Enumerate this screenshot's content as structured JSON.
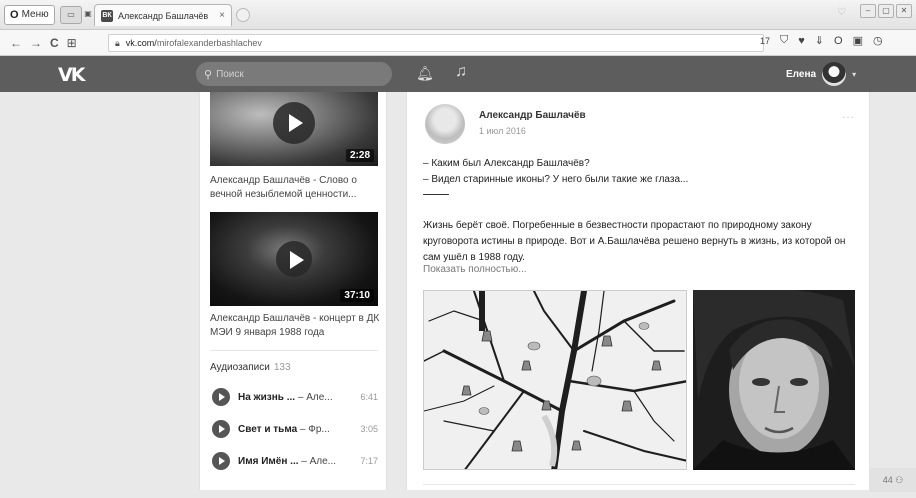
{
  "browser": {
    "menu_label": "Меню",
    "tab_title": "Александр Башлачёв",
    "tab_favicon": "ВК",
    "tab_close": "×",
    "url_host": "vk.com/",
    "url_path": "mirofalexanderbashlachev",
    "extension_count": "17",
    "nav_back": "←",
    "nav_forward": "→",
    "nav_reload": "C"
  },
  "vk_header": {
    "logo": "VK",
    "search_placeholder": "Поиск",
    "user_name": "Елена"
  },
  "videos": [
    {
      "title": "Александр Башлачёв - Слово о вечной незыблемой ценности...",
      "duration": "2:28"
    },
    {
      "title": "Александр Башлачёв - концерт в ДК МЭИ 9 января 1988 года",
      "duration": "37:10"
    }
  ],
  "audio": {
    "heading": "Аудиозаписи",
    "count": "133",
    "tracks": [
      {
        "title": "На жизнь ...",
        "artist": " – Але...",
        "time": "6:41"
      },
      {
        "title": "Свет и тьма",
        "artist": " – Фр...",
        "time": "3:05"
      },
      {
        "title": "Имя Имён ...",
        "artist": " – Але...",
        "time": "7:17"
      }
    ]
  },
  "post": {
    "author": "Александр Башлачёв",
    "date": "1 июл 2016",
    "menu_dots": "···",
    "line1": "– Каким был Александр Башлачёв?",
    "line2": "– Видел старинные иконы? У него были такие же глаза...",
    "body": "Жизнь берёт своё. Погребенные в безвестности прорастают по природному закону круговорота истины в природе. Вот и А.Башлачёва решено вернуть в жизнь, из которой он сам ушёл в 1988 году.",
    "show_more": "Показать полностью..."
  },
  "footer_counter": "44"
}
